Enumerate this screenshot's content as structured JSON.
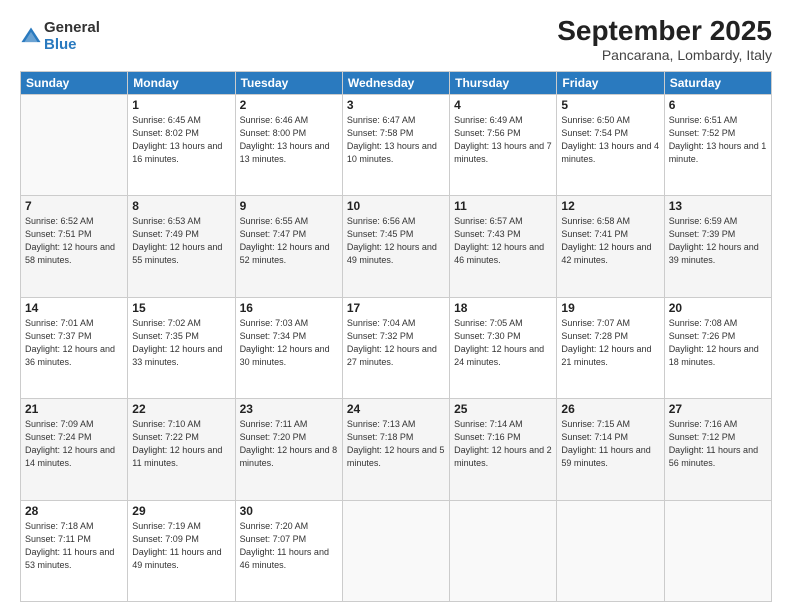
{
  "logo": {
    "general": "General",
    "blue": "Blue"
  },
  "title": "September 2025",
  "subtitle": "Pancarana, Lombardy, Italy",
  "days_of_week": [
    "Sunday",
    "Monday",
    "Tuesday",
    "Wednesday",
    "Thursday",
    "Friday",
    "Saturday"
  ],
  "weeks": [
    [
      {
        "day": "",
        "sunrise": "",
        "sunset": "",
        "daylight": ""
      },
      {
        "day": "1",
        "sunrise": "Sunrise: 6:45 AM",
        "sunset": "Sunset: 8:02 PM",
        "daylight": "Daylight: 13 hours and 16 minutes."
      },
      {
        "day": "2",
        "sunrise": "Sunrise: 6:46 AM",
        "sunset": "Sunset: 8:00 PM",
        "daylight": "Daylight: 13 hours and 13 minutes."
      },
      {
        "day": "3",
        "sunrise": "Sunrise: 6:47 AM",
        "sunset": "Sunset: 7:58 PM",
        "daylight": "Daylight: 13 hours and 10 minutes."
      },
      {
        "day": "4",
        "sunrise": "Sunrise: 6:49 AM",
        "sunset": "Sunset: 7:56 PM",
        "daylight": "Daylight: 13 hours and 7 minutes."
      },
      {
        "day": "5",
        "sunrise": "Sunrise: 6:50 AM",
        "sunset": "Sunset: 7:54 PM",
        "daylight": "Daylight: 13 hours and 4 minutes."
      },
      {
        "day": "6",
        "sunrise": "Sunrise: 6:51 AM",
        "sunset": "Sunset: 7:52 PM",
        "daylight": "Daylight: 13 hours and 1 minute."
      }
    ],
    [
      {
        "day": "7",
        "sunrise": "Sunrise: 6:52 AM",
        "sunset": "Sunset: 7:51 PM",
        "daylight": "Daylight: 12 hours and 58 minutes."
      },
      {
        "day": "8",
        "sunrise": "Sunrise: 6:53 AM",
        "sunset": "Sunset: 7:49 PM",
        "daylight": "Daylight: 12 hours and 55 minutes."
      },
      {
        "day": "9",
        "sunrise": "Sunrise: 6:55 AM",
        "sunset": "Sunset: 7:47 PM",
        "daylight": "Daylight: 12 hours and 52 minutes."
      },
      {
        "day": "10",
        "sunrise": "Sunrise: 6:56 AM",
        "sunset": "Sunset: 7:45 PM",
        "daylight": "Daylight: 12 hours and 49 minutes."
      },
      {
        "day": "11",
        "sunrise": "Sunrise: 6:57 AM",
        "sunset": "Sunset: 7:43 PM",
        "daylight": "Daylight: 12 hours and 46 minutes."
      },
      {
        "day": "12",
        "sunrise": "Sunrise: 6:58 AM",
        "sunset": "Sunset: 7:41 PM",
        "daylight": "Daylight: 12 hours and 42 minutes."
      },
      {
        "day": "13",
        "sunrise": "Sunrise: 6:59 AM",
        "sunset": "Sunset: 7:39 PM",
        "daylight": "Daylight: 12 hours and 39 minutes."
      }
    ],
    [
      {
        "day": "14",
        "sunrise": "Sunrise: 7:01 AM",
        "sunset": "Sunset: 7:37 PM",
        "daylight": "Daylight: 12 hours and 36 minutes."
      },
      {
        "day": "15",
        "sunrise": "Sunrise: 7:02 AM",
        "sunset": "Sunset: 7:35 PM",
        "daylight": "Daylight: 12 hours and 33 minutes."
      },
      {
        "day": "16",
        "sunrise": "Sunrise: 7:03 AM",
        "sunset": "Sunset: 7:34 PM",
        "daylight": "Daylight: 12 hours and 30 minutes."
      },
      {
        "day": "17",
        "sunrise": "Sunrise: 7:04 AM",
        "sunset": "Sunset: 7:32 PM",
        "daylight": "Daylight: 12 hours and 27 minutes."
      },
      {
        "day": "18",
        "sunrise": "Sunrise: 7:05 AM",
        "sunset": "Sunset: 7:30 PM",
        "daylight": "Daylight: 12 hours and 24 minutes."
      },
      {
        "day": "19",
        "sunrise": "Sunrise: 7:07 AM",
        "sunset": "Sunset: 7:28 PM",
        "daylight": "Daylight: 12 hours and 21 minutes."
      },
      {
        "day": "20",
        "sunrise": "Sunrise: 7:08 AM",
        "sunset": "Sunset: 7:26 PM",
        "daylight": "Daylight: 12 hours and 18 minutes."
      }
    ],
    [
      {
        "day": "21",
        "sunrise": "Sunrise: 7:09 AM",
        "sunset": "Sunset: 7:24 PM",
        "daylight": "Daylight: 12 hours and 14 minutes."
      },
      {
        "day": "22",
        "sunrise": "Sunrise: 7:10 AM",
        "sunset": "Sunset: 7:22 PM",
        "daylight": "Daylight: 12 hours and 11 minutes."
      },
      {
        "day": "23",
        "sunrise": "Sunrise: 7:11 AM",
        "sunset": "Sunset: 7:20 PM",
        "daylight": "Daylight: 12 hours and 8 minutes."
      },
      {
        "day": "24",
        "sunrise": "Sunrise: 7:13 AM",
        "sunset": "Sunset: 7:18 PM",
        "daylight": "Daylight: 12 hours and 5 minutes."
      },
      {
        "day": "25",
        "sunrise": "Sunrise: 7:14 AM",
        "sunset": "Sunset: 7:16 PM",
        "daylight": "Daylight: 12 hours and 2 minutes."
      },
      {
        "day": "26",
        "sunrise": "Sunrise: 7:15 AM",
        "sunset": "Sunset: 7:14 PM",
        "daylight": "Daylight: 11 hours and 59 minutes."
      },
      {
        "day": "27",
        "sunrise": "Sunrise: 7:16 AM",
        "sunset": "Sunset: 7:12 PM",
        "daylight": "Daylight: 11 hours and 56 minutes."
      }
    ],
    [
      {
        "day": "28",
        "sunrise": "Sunrise: 7:18 AM",
        "sunset": "Sunset: 7:11 PM",
        "daylight": "Daylight: 11 hours and 53 minutes."
      },
      {
        "day": "29",
        "sunrise": "Sunrise: 7:19 AM",
        "sunset": "Sunset: 7:09 PM",
        "daylight": "Daylight: 11 hours and 49 minutes."
      },
      {
        "day": "30",
        "sunrise": "Sunrise: 7:20 AM",
        "sunset": "Sunset: 7:07 PM",
        "daylight": "Daylight: 11 hours and 46 minutes."
      },
      {
        "day": "",
        "sunrise": "",
        "sunset": "",
        "daylight": ""
      },
      {
        "day": "",
        "sunrise": "",
        "sunset": "",
        "daylight": ""
      },
      {
        "day": "",
        "sunrise": "",
        "sunset": "",
        "daylight": ""
      },
      {
        "day": "",
        "sunrise": "",
        "sunset": "",
        "daylight": ""
      }
    ]
  ]
}
